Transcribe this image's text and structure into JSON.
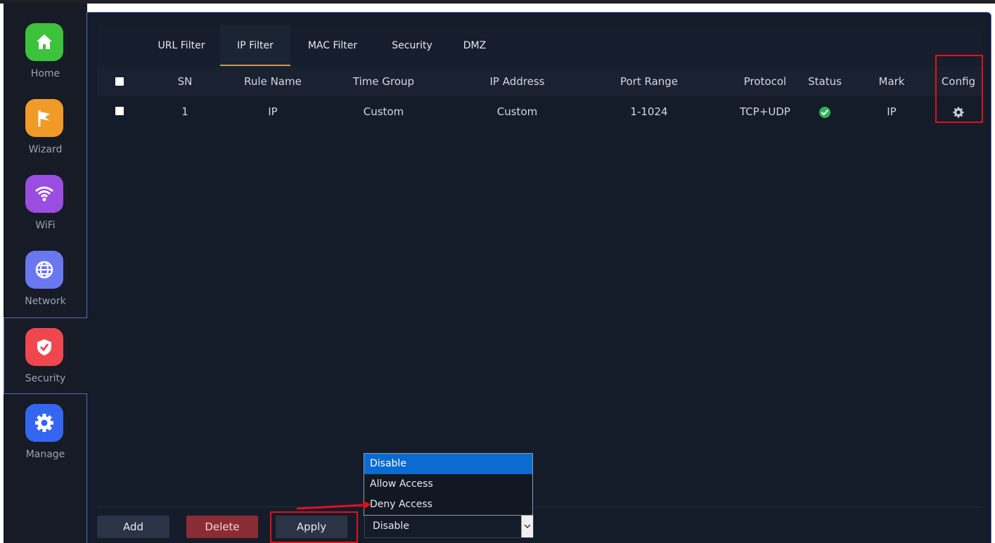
{
  "sidebar": {
    "items": [
      {
        "label": "Home",
        "icon": "home-icon",
        "color": "#3dc23c"
      },
      {
        "label": "Wizard",
        "icon": "flag-icon",
        "color": "#f09a28"
      },
      {
        "label": "WiFi",
        "icon": "wifi-icon",
        "color": "#9a4de0"
      },
      {
        "label": "Network",
        "icon": "globe-icon",
        "color": "#6a78f0"
      },
      {
        "label": "Security",
        "icon": "shield-icon",
        "color": "#f0474f"
      },
      {
        "label": "Manage",
        "icon": "gear-icon",
        "color": "#3466f2"
      }
    ],
    "active": "Security"
  },
  "tabs": [
    "URL Filter",
    "IP Filter",
    "MAC Filter",
    "Security",
    "DMZ"
  ],
  "active_tab": "IP Filter",
  "table": {
    "headers": [
      "SN",
      "Rule Name",
      "Time Group",
      "IP Address",
      "Port Range",
      "Protocol",
      "Status",
      "Mark",
      "Config"
    ],
    "rows": [
      {
        "sn": "1",
        "rule_name": "IP",
        "time_group": "Custom",
        "ip_address": "Custom",
        "port_range": "1-1024",
        "protocol": "TCP+UDP",
        "status": "enabled",
        "mark": "IP"
      }
    ]
  },
  "buttons": {
    "add": "Add",
    "delete": "Delete",
    "apply": "Apply"
  },
  "action_select": {
    "value": "Disable",
    "options": [
      "Disable",
      "Allow Access",
      "Deny Access"
    ],
    "highlighted": "Disable"
  },
  "colors": {
    "accent_tab": "#c99a55",
    "status_ok": "#2fb35a",
    "annotation": "#e3101e",
    "selected_option": "#0a6bd1"
  }
}
